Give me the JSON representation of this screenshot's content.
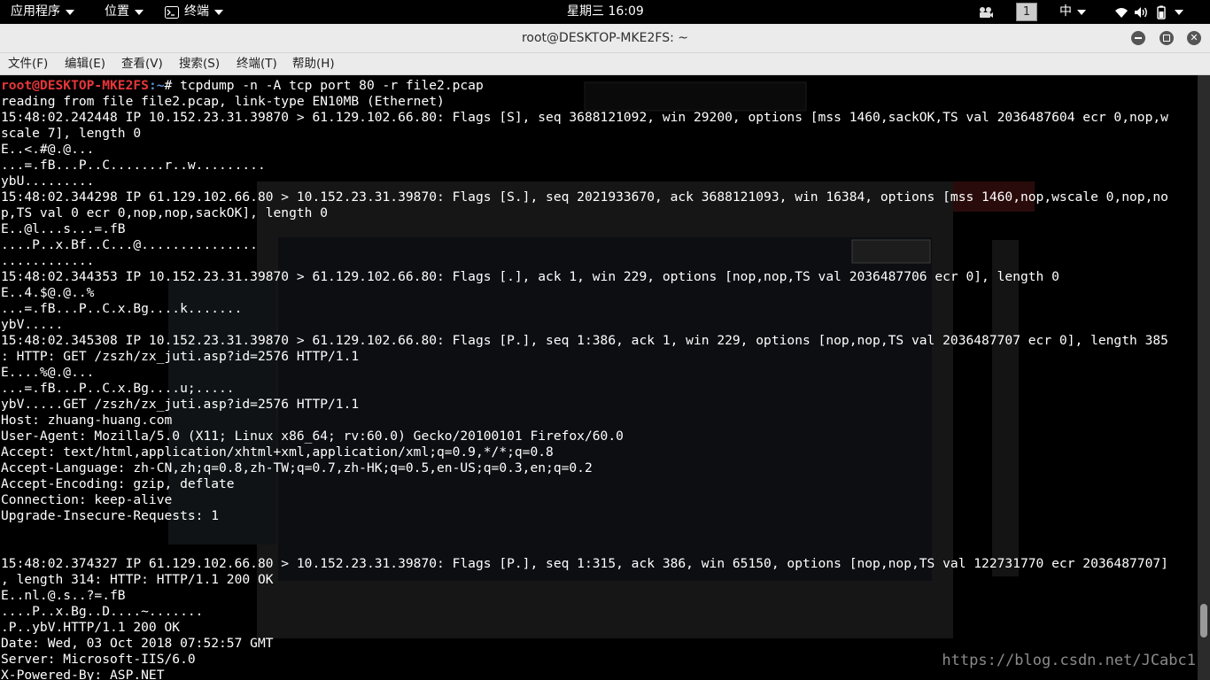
{
  "topbar": {
    "applications": "应用程序",
    "places": "位置",
    "terminal": "终端",
    "clock": "星期三 16:09",
    "workspace": "1",
    "input_method": "中"
  },
  "window": {
    "title": "root@DESKTOP-MKE2FS: ~"
  },
  "menu": {
    "file": "文件(F)",
    "edit": "编辑(E)",
    "view": "查看(V)",
    "search": "搜索(S)",
    "terminal": "终端(T)",
    "help": "帮助(H)"
  },
  "terminal": {
    "prompt_user": "root@DESKTOP-MKE2FS",
    "prompt_path": ":~",
    "command": "# tcpdump -n -A tcp port 80 -r file2.pcap",
    "lines": [
      "reading from file file2.pcap, link-type EN10MB (Ethernet)",
      "15:48:02.242448 IP 10.152.23.31.39870 > 61.129.102.66.80: Flags [S], seq 3688121092, win 29200, options [mss 1460,sackOK,TS val 2036487604 ecr 0,nop,w",
      "scale 7], length 0",
      "E..<.#@.@...",
      "...=.fB...P..C.......r..w.........",
      "ybU.........",
      "15:48:02.344298 IP 61.129.102.66.80 > 10.152.23.31.39870: Flags [S.], seq 2021933670, ack 3688121093, win 16384, options [mss 1460,nop,wscale 0,nop,no",
      "p,TS val 0 ecr 0,nop,nop,sackOK], length 0",
      "E..@l...s...=.fB",
      "....P..x.Bf..C...@...............",
      "............",
      "15:48:02.344353 IP 10.152.23.31.39870 > 61.129.102.66.80: Flags [.], ack 1, win 229, options [nop,nop,TS val 2036487706 ecr 0], length 0",
      "E..4.$@.@..%",
      "...=.fB...P..C.x.Bg....k.......",
      "ybV.....",
      "15:48:02.345308 IP 10.152.23.31.39870 > 61.129.102.66.80: Flags [P.], seq 1:386, ack 1, win 229, options [nop,nop,TS val 2036487707 ecr 0], length 385",
      ": HTTP: GET /zszh/zx_juti.asp?id=2576 HTTP/1.1",
      "E....%@.@...",
      "...=.fB...P..C.x.Bg....u;.....",
      "ybV.....GET /zszh/zx_juti.asp?id=2576 HTTP/1.1",
      "Host: zhuang-huang.com",
      "User-Agent: Mozilla/5.0 (X11; Linux x86_64; rv:60.0) Gecko/20100101 Firefox/60.0",
      "Accept: text/html,application/xhtml+xml,application/xml;q=0.9,*/*;q=0.8",
      "Accept-Language: zh-CN,zh;q=0.8,zh-TW;q=0.7,zh-HK;q=0.5,en-US;q=0.3,en;q=0.2",
      "Accept-Encoding: gzip, deflate",
      "Connection: keep-alive",
      "Upgrade-Insecure-Requests: 1",
      "",
      "",
      "15:48:02.374327 IP 61.129.102.66.80 > 10.152.23.31.39870: Flags [P.], seq 1:315, ack 386, win 65150, options [nop,nop,TS val 122731770 ecr 2036487707]",
      ", length 314: HTTP: HTTP/1.1 200 OK",
      "E..nl.@.s..?=.fB",
      "....P..x.Bg..D....~.......",
      ".P..ybV.HTTP/1.1 200 OK",
      "Date: Wed, 03 Oct 2018 07:52:57 GMT",
      "Server: Microsoft-IIS/6.0",
      "X-Powered-By: ASP.NET"
    ]
  },
  "watermark": "https://blog.csdn.net/JCabc1"
}
